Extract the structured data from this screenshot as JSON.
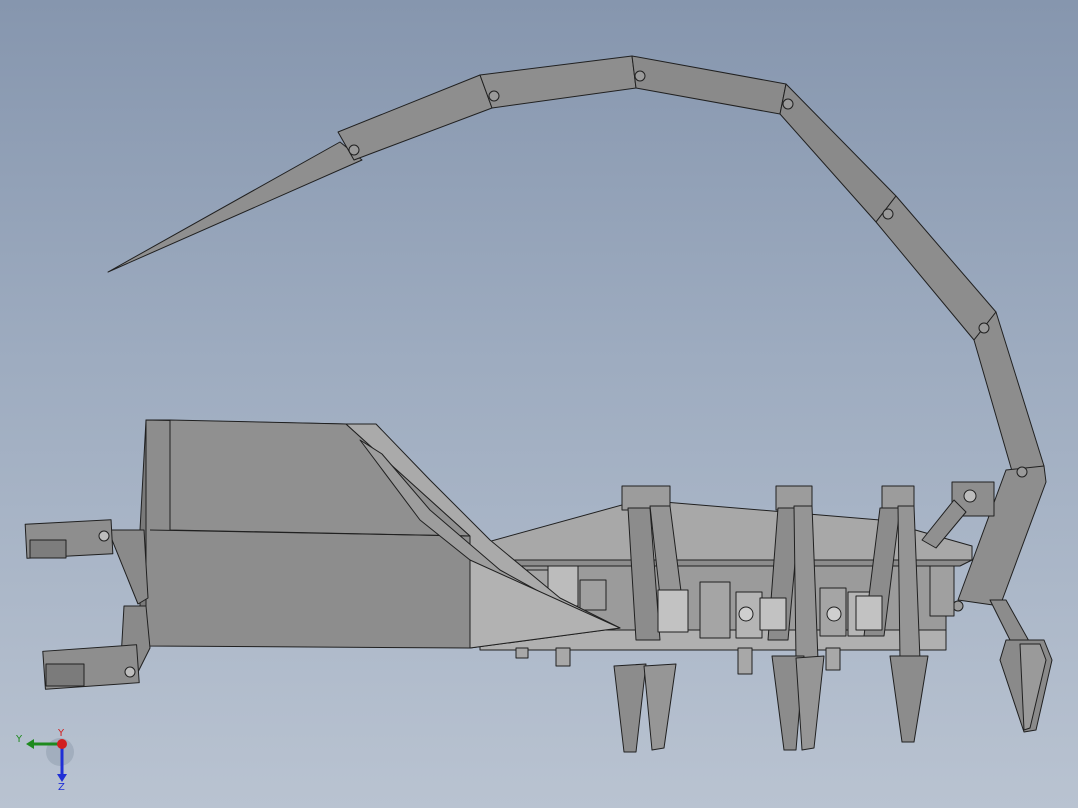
{
  "viewport": {
    "background_top": "#8696ae",
    "background_bottom": "#b9c3d1"
  },
  "model": {
    "shade_dark": "#6f6f6f",
    "shade_mid": "#8c8c8c",
    "shade_light": "#a9a9a9",
    "shade_pale": "#c4c4c4",
    "edge_color": "#202020"
  },
  "triad": {
    "x_axis_label": "Y",
    "y_axis_label": "Y",
    "z_axis_label": "Z",
    "y_color": "#1e8a1e",
    "z_color": "#1f2fd6",
    "x_color": "#d11f1f",
    "icon": "view-orientation-triad-icon"
  }
}
